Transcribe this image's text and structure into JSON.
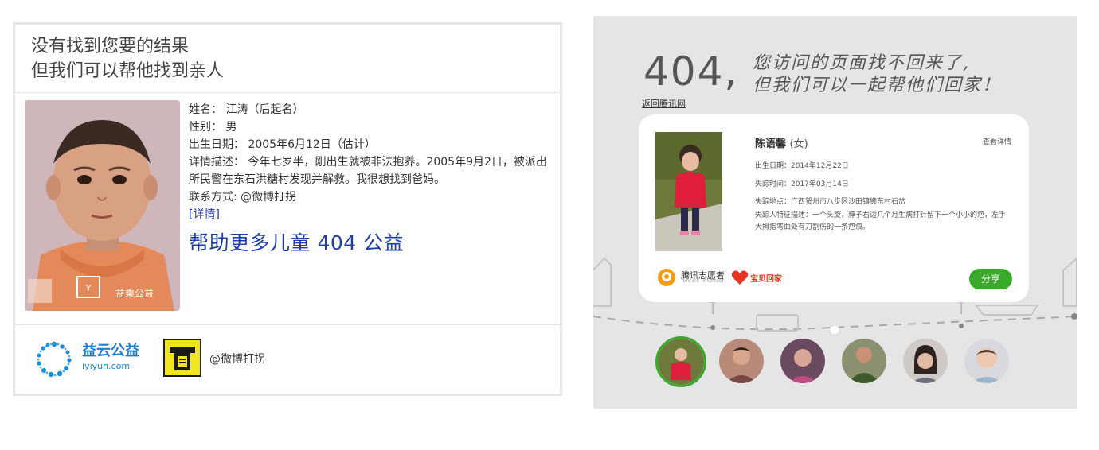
{
  "left": {
    "heading_line1": "没有找到您要的结果",
    "heading_line2": "但我们可以帮他找到亲人",
    "info": {
      "name": "姓名：  江涛（后起名）",
      "gender": "性别：  男",
      "birth": "出生日期：  2005年6月12日（估计）",
      "desc": "详情描述：  今年七岁半，刚出生就被非法抱养。2005年9月2日，被派出所民警在东石洪糖村发现并解救。我很想找到爸妈。",
      "contact": "联系方式: @微博打拐",
      "detail_link": "[详情]",
      "big_link": "帮助更多儿童 404 公益"
    },
    "photo_watermark": "益乘公益",
    "footer": {
      "yiyun_cn": "益云公益",
      "yiyun_en": "iyiyun.com",
      "weibo_text": "@微博打拐"
    }
  },
  "right": {
    "big_404": "404,",
    "msg_line1": "您访问的页面找不回来了,",
    "msg_line2": "但我们可以一起帮他们回家！",
    "back_link": "返回腾讯网",
    "card": {
      "name": "陈语馨",
      "gender": "(女)",
      "more_link": "查看详情",
      "birth": "出生日期：2014年12月22日",
      "lost_time": "失踪时间：2017年03月14日",
      "lost_place": "失踪地点：广西贺州市八步区沙田镇狮东村石岔",
      "features": "失踪人特征描述：一个头旋，脖子右边几个月生病打针留下一个小小的疤，左手大拇指弯曲处有刀割伤的一条疤痕。",
      "logo1_cn": "腾讯志愿者",
      "logo1_en": "Tencent Volunteer",
      "logo2": "宝贝回家",
      "share_label": "分享"
    },
    "avatars": [
      "child-1",
      "child-2",
      "child-3",
      "child-4",
      "child-5",
      "child-6"
    ],
    "colors": {
      "accent": "#3aaa2b",
      "bg": "#e5e5e5"
    }
  }
}
